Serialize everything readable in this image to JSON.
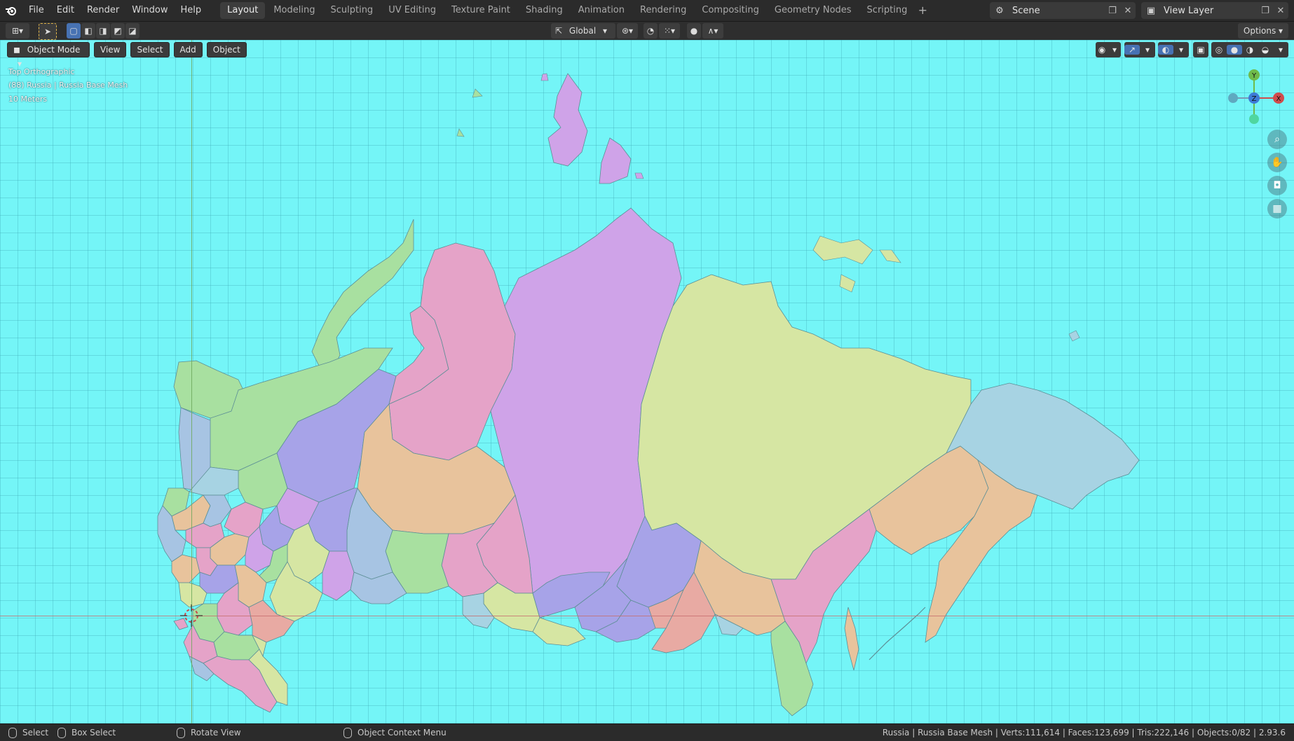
{
  "menu": [
    "File",
    "Edit",
    "Render",
    "Window",
    "Help"
  ],
  "workspaces": [
    "Layout",
    "Modeling",
    "Sculpting",
    "UV Editing",
    "Texture Paint",
    "Shading",
    "Animation",
    "Rendering",
    "Compositing",
    "Geometry Nodes",
    "Scripting"
  ],
  "active_workspace": "Layout",
  "scene": {
    "name": "Scene"
  },
  "view_layer": {
    "name": "View Layer"
  },
  "toolbar": {
    "transform_orientation": "Global",
    "options_label": "Options"
  },
  "viewport_header": {
    "mode": "Object Mode",
    "view": "View",
    "select": "Select",
    "add": "Add",
    "object": "Object"
  },
  "overlay": {
    "view_name": "Top Orthographic",
    "object_info": "(88) Russia | Russia Base Mesh",
    "scale": "10 Meters"
  },
  "gizmo": {
    "x": "X",
    "y": "Y",
    "z": "Z"
  },
  "status": {
    "select": "Select",
    "box_select": "Box Select",
    "rotate_view": "Rotate View",
    "context_menu": "Object Context Menu",
    "info": "Russia | Russia Base Mesh | Verts:111,614 | Faces:123,699 | Tris:222,146 | Objects:0/82 | 2.93.6"
  },
  "colors": {
    "viewport_bg": "#74f5f7",
    "accent": "#4772b3",
    "region_purple": "#cfa3e8",
    "region_yellow": "#d6e6a3",
    "region_pink": "#e5a3c8",
    "region_blue": "#a7d3e3",
    "region_orange": "#e8c39c",
    "region_green": "#a8e0a0"
  },
  "icons": {
    "logo": "blender-logo-icon",
    "zoom": "zoom-icon",
    "pan": "hand-icon",
    "camera": "camera-icon",
    "grid": "grid-icon"
  }
}
